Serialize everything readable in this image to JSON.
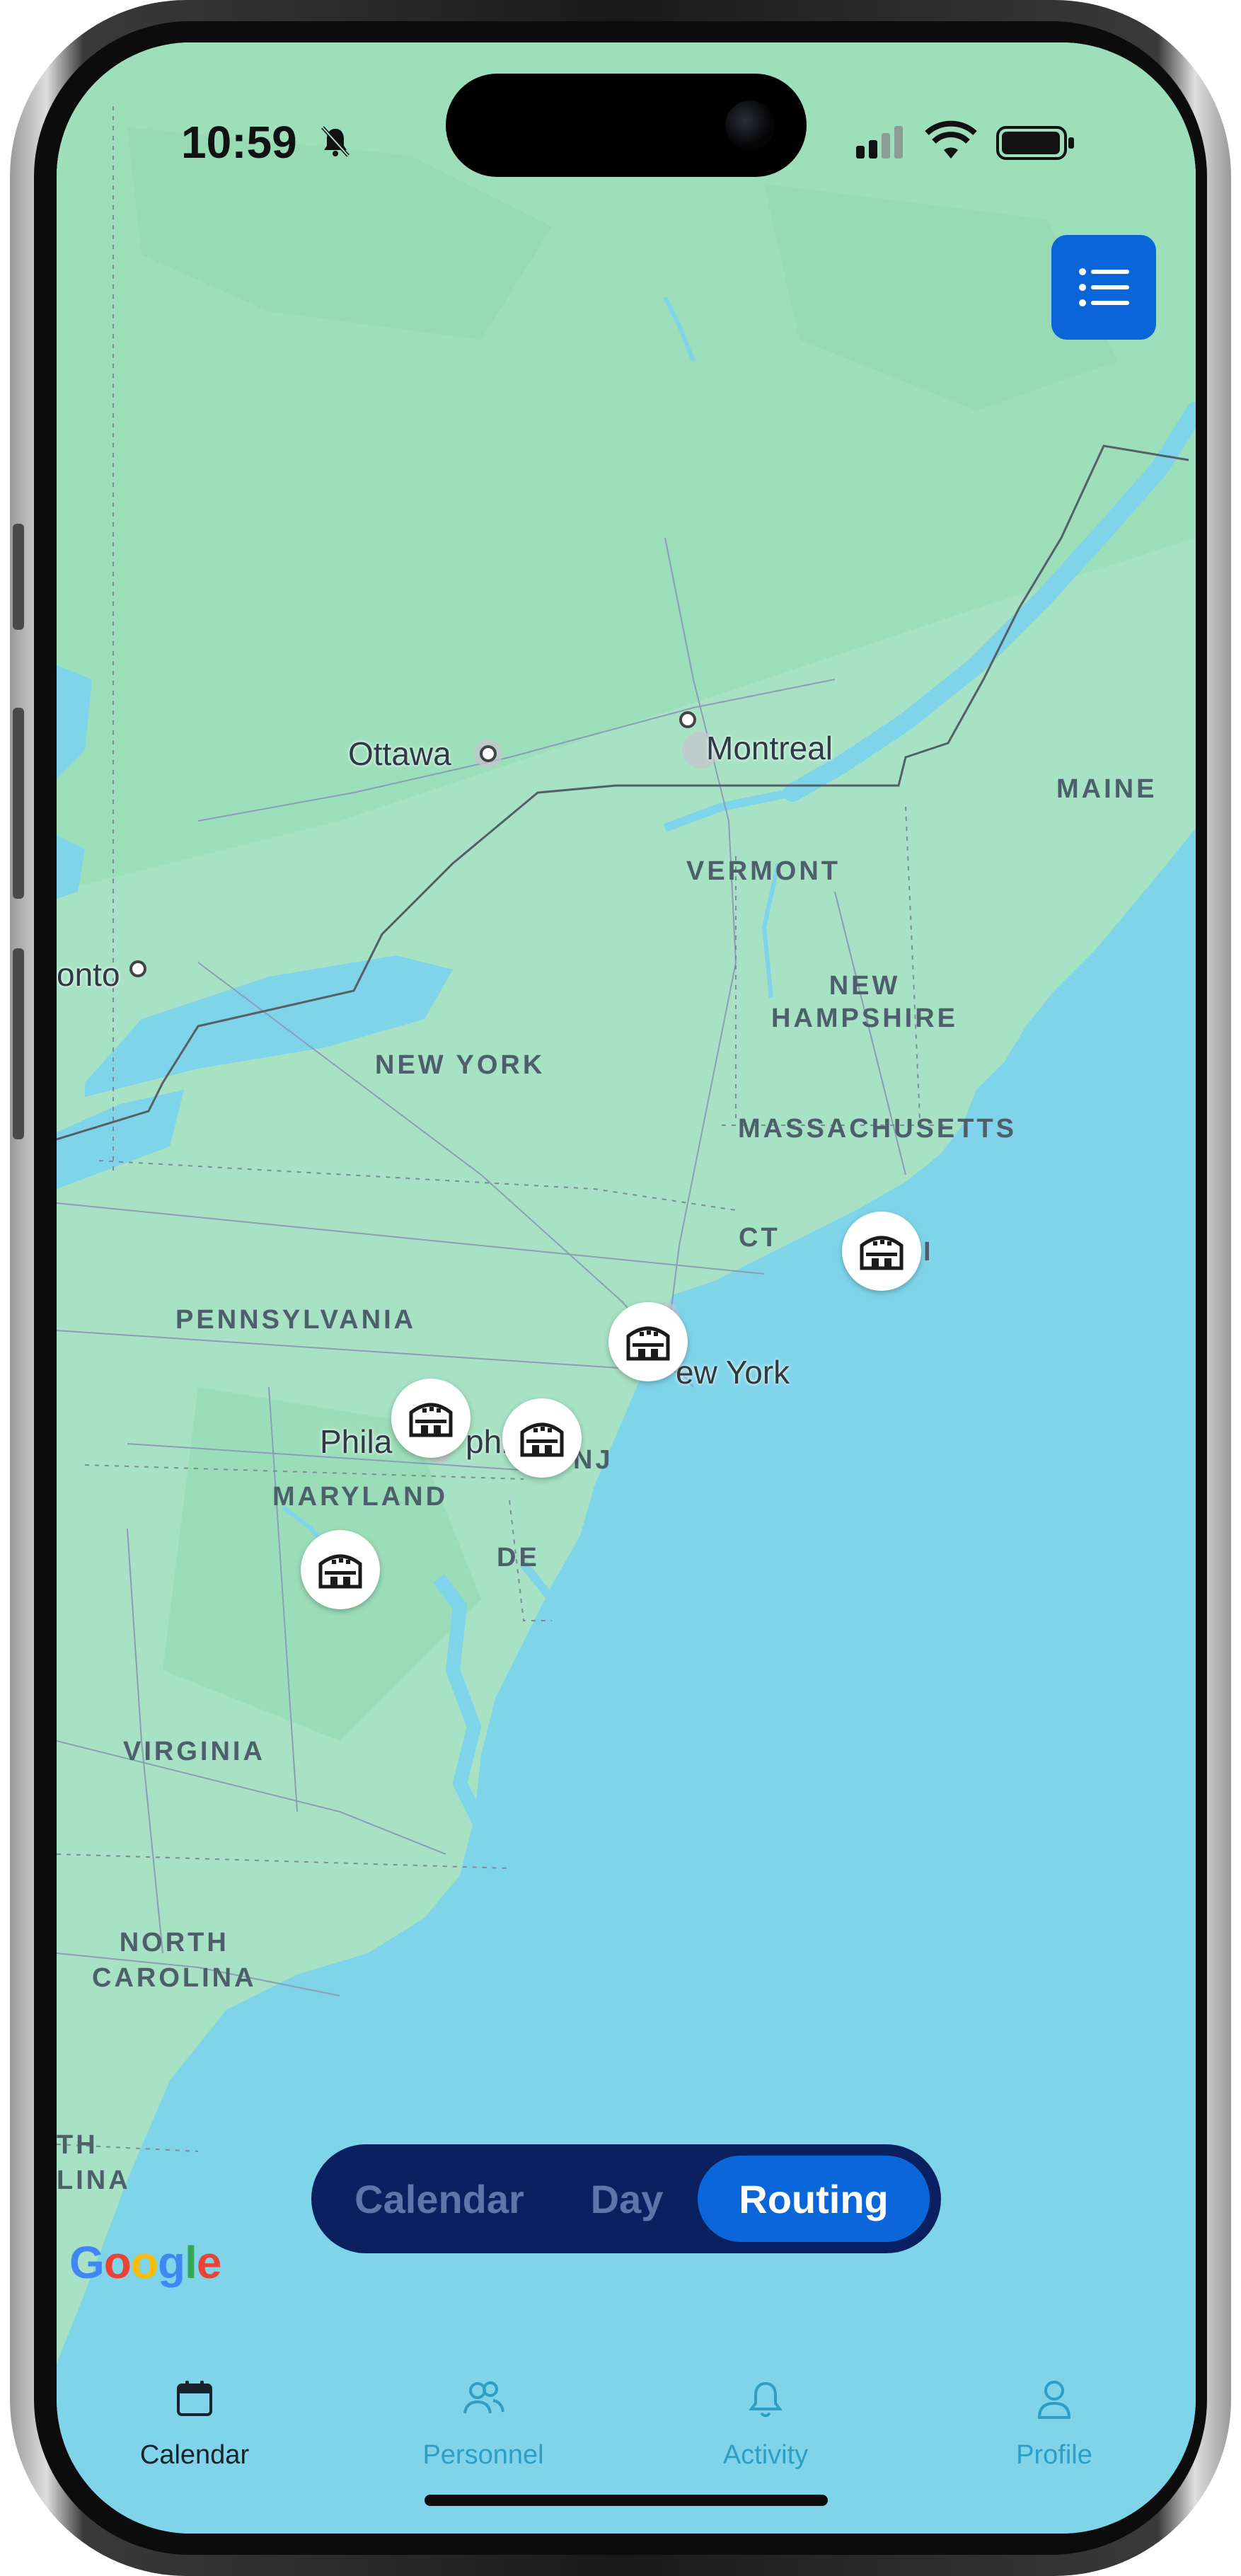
{
  "status_bar": {
    "time": "10:59"
  },
  "map": {
    "cities": [
      {
        "id": "ottawa",
        "name": "Ottawa"
      },
      {
        "id": "montreal",
        "name": "Montreal"
      },
      {
        "id": "toronto",
        "name": "onto"
      },
      {
        "id": "new-york-city",
        "name": "ew York"
      },
      {
        "id": "philadelphia-a",
        "name": "Phila"
      },
      {
        "id": "philadelphia-b",
        "name": "phi"
      }
    ],
    "regions": [
      {
        "id": "maine",
        "name": "MAINE"
      },
      {
        "id": "vermont",
        "name": "VERMONT"
      },
      {
        "id": "new-hampshire",
        "name": "NEW\nHAMPSHIRE"
      },
      {
        "id": "new-york",
        "name": "NEW YORK"
      },
      {
        "id": "massachusetts",
        "name": "MASSACHUSETTS"
      },
      {
        "id": "ct",
        "name": "CT"
      },
      {
        "id": "ri",
        "name": "I"
      },
      {
        "id": "pennsylvania",
        "name": "PENNSYLVANIA"
      },
      {
        "id": "nj",
        "name": "NJ"
      },
      {
        "id": "maryland",
        "name": "MARYLAND"
      },
      {
        "id": "de",
        "name": "DE"
      },
      {
        "id": "virginia",
        "name": "VIRGINIA"
      },
      {
        "id": "north-carolina",
        "name": "NORTH\nCAROLINA"
      },
      {
        "id": "south-carolina",
        "name": "TH\nLINA"
      }
    ],
    "attribution": {
      "G": "G",
      "o1": "o",
      "o2": "o",
      "g": "g",
      "l": "l",
      "e": "e"
    },
    "attribution_colors": [
      "#4285F4",
      "#EA4335",
      "#FBBC05",
      "#4285F4",
      "#34A853",
      "#EA4335"
    ],
    "venue_pin_icon": "arena-icon",
    "venue_pin_count": 5
  },
  "view_switcher": {
    "options": [
      "Calendar",
      "Day",
      "Routing"
    ],
    "selected": "Routing"
  },
  "tab_bar": {
    "items": [
      {
        "label": "Calendar",
        "icon": "calendar-icon",
        "active": true
      },
      {
        "label": "Personnel",
        "icon": "people-icon",
        "active": false
      },
      {
        "label": "Activity",
        "icon": "bell-icon",
        "active": false
      },
      {
        "label": "Profile",
        "icon": "person-icon",
        "active": false
      }
    ]
  },
  "colors": {
    "water": "#7fd4ea",
    "land": "#a6e2c3",
    "accent": "#0b67d9",
    "switcher_bg": "#0b2060",
    "tab_inactive": "#2f9ec4"
  }
}
